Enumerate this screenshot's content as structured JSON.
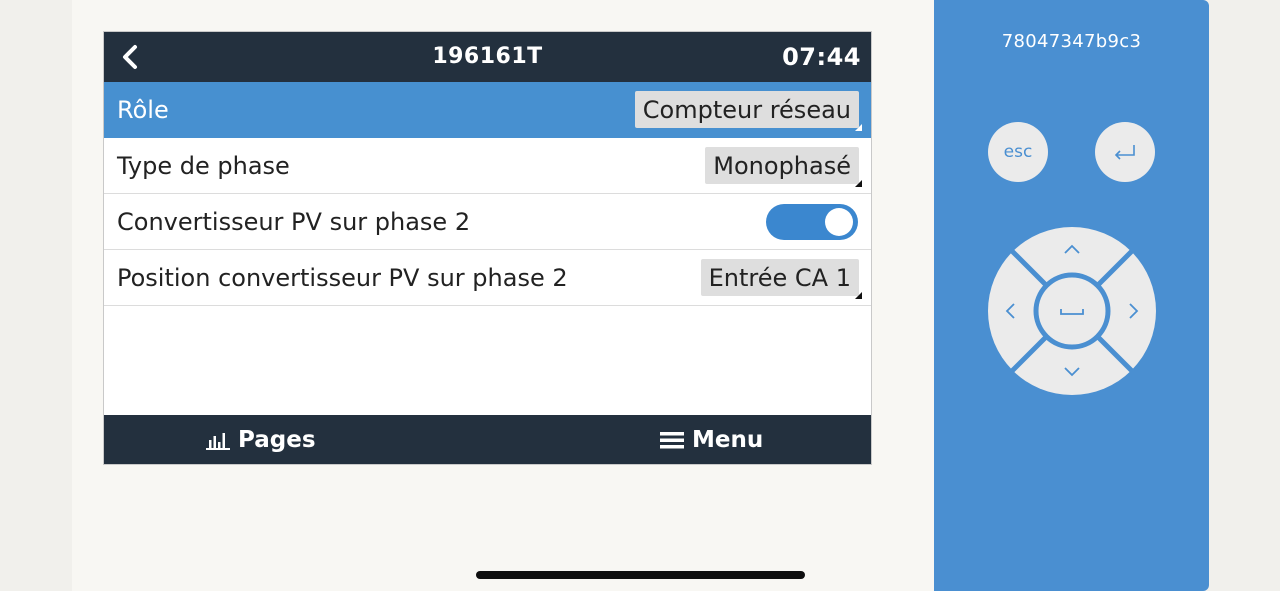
{
  "screen": {
    "header": {
      "title": "196161T",
      "time": "07:44"
    },
    "rows": [
      {
        "label": "Rôle",
        "value": "Compteur réseau",
        "selected": true
      },
      {
        "label": "Type de phase",
        "value": "Monophasé"
      },
      {
        "label": "Convertisseur PV sur phase 2",
        "toggle_on": true
      },
      {
        "label": "Position convertisseur PV sur phase 2",
        "value": "Entrée CA 1"
      }
    ],
    "footer": {
      "pages_label": "Pages",
      "menu_label": "Menu"
    }
  },
  "remote": {
    "device_id": "78047347b9c3",
    "esc_label": "esc",
    "enter_icon": "return-icon",
    "dpad_icons": [
      "chevron-up-icon",
      "chevron-down-icon",
      "chevron-left-icon",
      "chevron-right-icon",
      "space-icon"
    ]
  },
  "colors": {
    "header_bg": "#23303e",
    "selected_row": "#4790d0",
    "remote_bg": "#4a8fd1",
    "toggle_on": "#3b87cf"
  }
}
